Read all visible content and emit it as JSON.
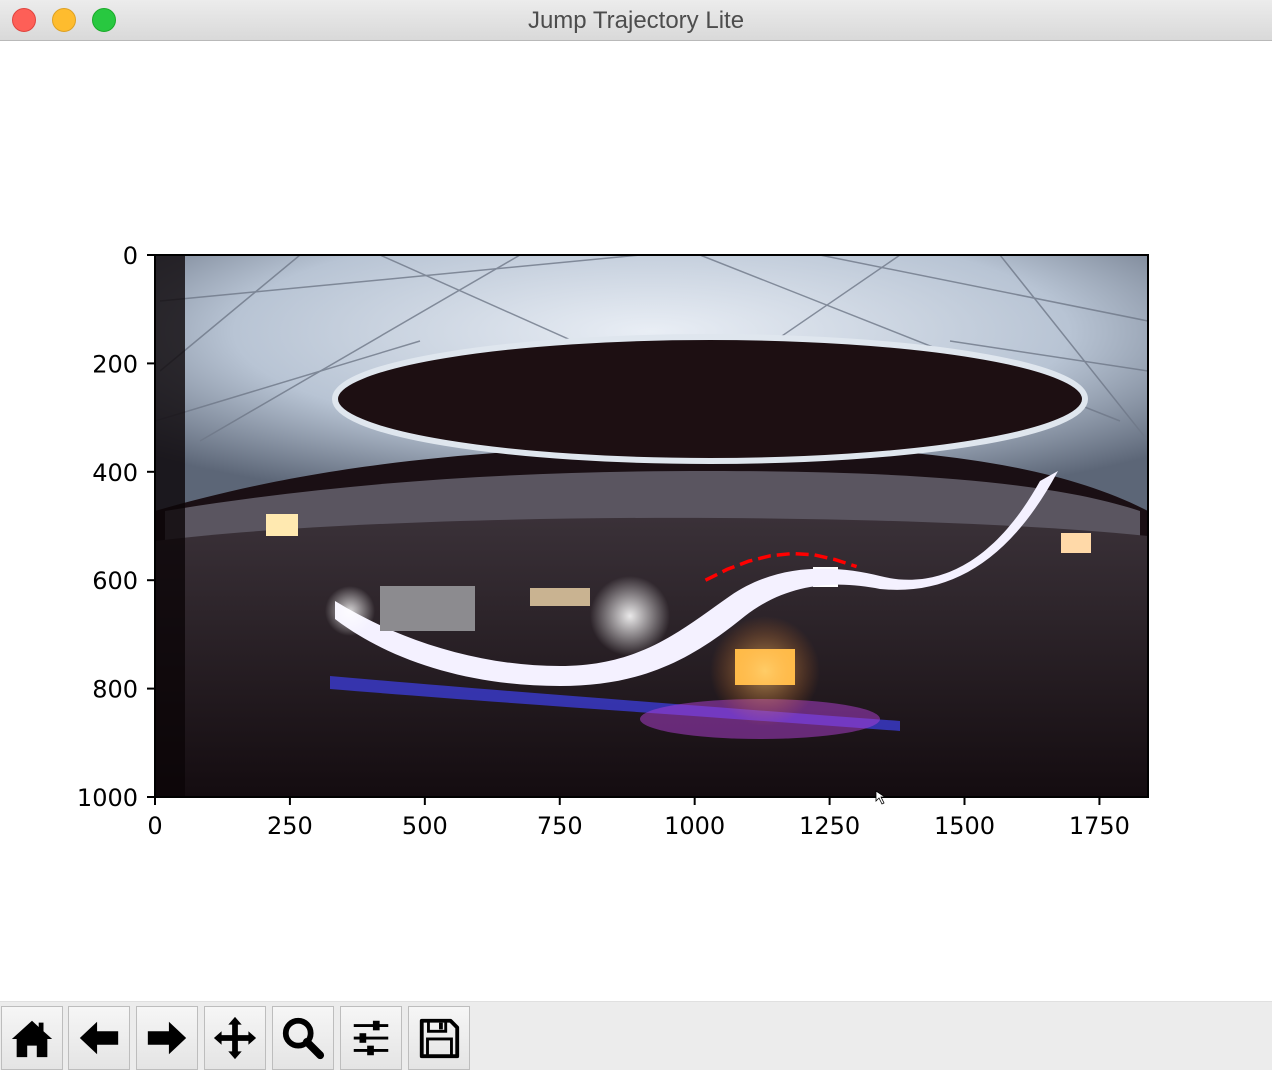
{
  "window": {
    "title": "Jump Trajectory Lite"
  },
  "chart_data": {
    "type": "image",
    "xlim": [
      0,
      1840
    ],
    "ylim": [
      1000,
      0
    ],
    "x_ticks": [
      0,
      250,
      500,
      750,
      1000,
      1250,
      1500,
      1750
    ],
    "y_ticks": [
      0,
      200,
      400,
      600,
      800,
      1000
    ],
    "series": [
      {
        "style": "dashed",
        "color": "#ff0000",
        "x": [
          1020,
          1060,
          1100,
          1140,
          1180,
          1220,
          1260,
          1300
        ],
        "y": [
          600,
          580,
          565,
          555,
          551,
          553,
          562,
          575
        ]
      }
    ]
  },
  "toolbar": {
    "buttons": [
      {
        "icon": "home-icon"
      },
      {
        "icon": "back-arrow-icon"
      },
      {
        "icon": "forward-arrow-icon"
      },
      {
        "icon": "pan-move-icon"
      },
      {
        "icon": "zoom-magnifier-icon"
      },
      {
        "icon": "configure-subplots-icon"
      },
      {
        "icon": "save-floppy-icon"
      }
    ]
  },
  "colors": {
    "trajectory": "#ff0000",
    "track_light": "#f4f1ff",
    "roof": "#c8d2e0",
    "dark_bg": "#1a0f14"
  }
}
